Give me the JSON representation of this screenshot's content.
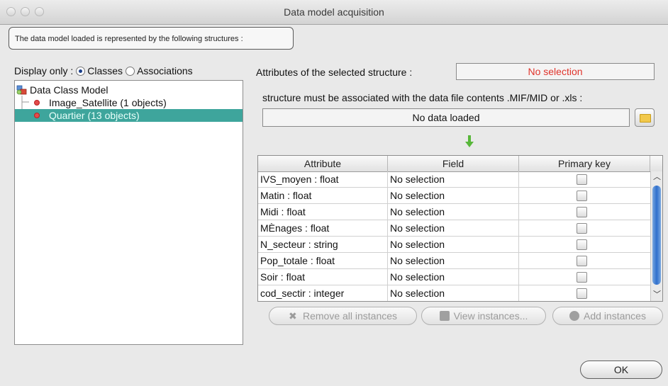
{
  "window": {
    "title": "Data model acquisition"
  },
  "intro": {
    "text": "The data model loaded is represented by the following structures :"
  },
  "display_only": {
    "label": "Display only :",
    "options": [
      {
        "label": "Classes",
        "selected": true
      },
      {
        "label": "Associations",
        "selected": false
      }
    ]
  },
  "tree": {
    "root": "Data Class Model",
    "items": [
      {
        "label": "Image_Satellite (1 objects)",
        "selected": false
      },
      {
        "label": "Quartier (13 objects)",
        "selected": true
      }
    ]
  },
  "attributes_panel": {
    "label": "Attributes of the selected structure :",
    "value": "No selection",
    "value_color": "#e0342c",
    "hint": "structure must be associated with the data file contents .MIF/MID or .xls :",
    "data_file_value": "No data loaded"
  },
  "table": {
    "headers": [
      "Attribute",
      "Field",
      "Primary key"
    ],
    "rows": [
      {
        "attribute": "IVS_moyen : float",
        "field": "No selection",
        "primary_key": false
      },
      {
        "attribute": "Matin : float",
        "field": "No selection",
        "primary_key": false
      },
      {
        "attribute": "Midi : float",
        "field": "No selection",
        "primary_key": false
      },
      {
        "attribute": "MÈnages : float",
        "field": "No selection",
        "primary_key": false
      },
      {
        "attribute": "N_secteur : string",
        "field": "No selection",
        "primary_key": false
      },
      {
        "attribute": "Pop_totale : float",
        "field": "No selection",
        "primary_key": false
      },
      {
        "attribute": "Soir : float",
        "field": "No selection",
        "primary_key": false
      },
      {
        "attribute": "cod_sectir : integer",
        "field": "No selection",
        "primary_key": false
      }
    ]
  },
  "actions": {
    "remove_all": "Remove all instances",
    "view": "View instances...",
    "add": "Add instances",
    "ok": "OK"
  }
}
